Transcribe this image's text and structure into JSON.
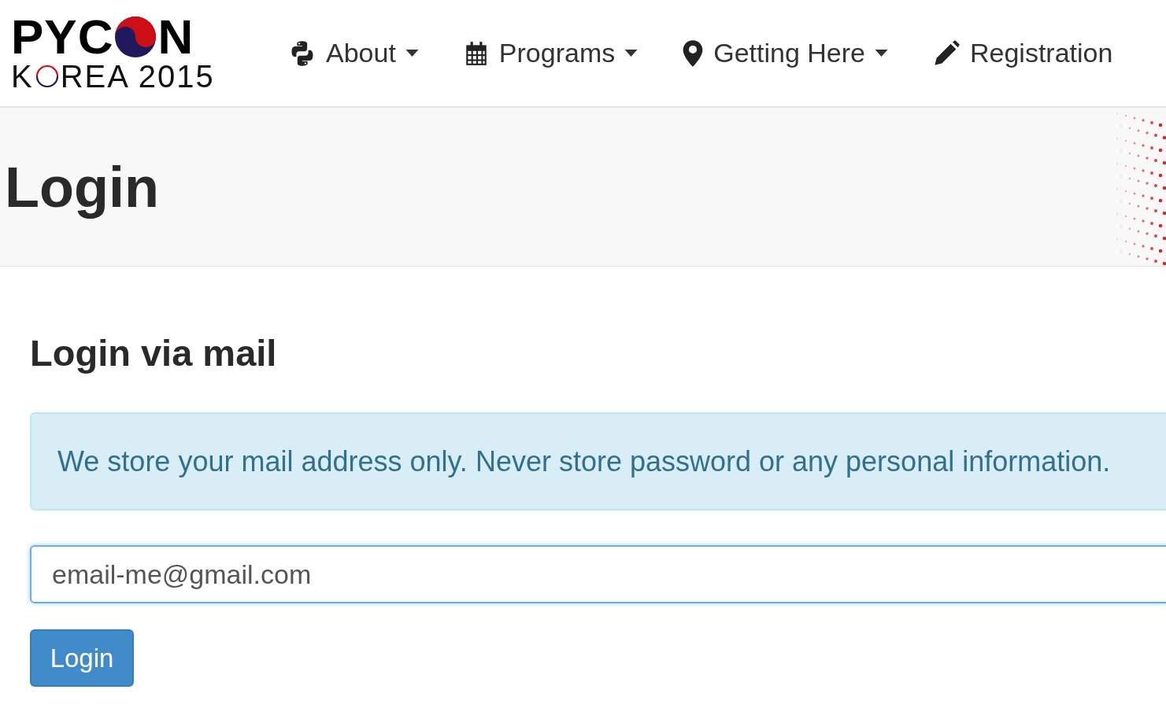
{
  "logo": {
    "line1": [
      "PYC",
      "N"
    ],
    "line2": [
      "K",
      "REA 2015"
    ]
  },
  "nav": [
    {
      "label": "About",
      "kind": "python",
      "dropdown": true
    },
    {
      "label": "Programs",
      "kind": "calendar",
      "dropdown": true
    },
    {
      "label": "Getting Here",
      "kind": "pin",
      "dropdown": true
    },
    {
      "label": "Registration",
      "kind": "pencil",
      "dropdown": false
    }
  ],
  "page_title": "Login",
  "section_title": "Login via mail",
  "alert": "We store your mail address only. Never store password or any personal information.",
  "email_field": {
    "value": "email-me@gmail.com",
    "focused": true
  },
  "submit_button": "Login"
}
